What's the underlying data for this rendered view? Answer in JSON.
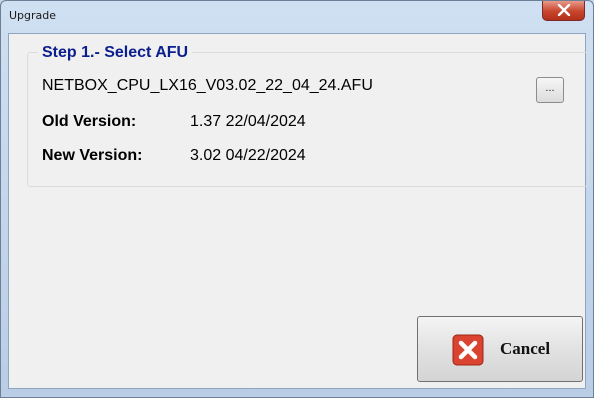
{
  "window": {
    "title": "Upgrade"
  },
  "step": {
    "title": "Step 1.- Select AFU",
    "filename": "NETBOX_CPU_LX16_V03.02_22_04_24.AFU",
    "browse_label": "...",
    "old_version_label": "Old Version:",
    "old_version_value": "1.37 22/04/2024",
    "new_version_label": "New Version:",
    "new_version_value": "3.02 04/22/2024"
  },
  "buttons": {
    "cancel_label": "Cancel"
  },
  "icons": {
    "close": "close-icon",
    "cancel": "cancel-x-icon"
  },
  "colors": {
    "step_title": "#0a1e8c",
    "cancel_icon": "#d9432f"
  }
}
